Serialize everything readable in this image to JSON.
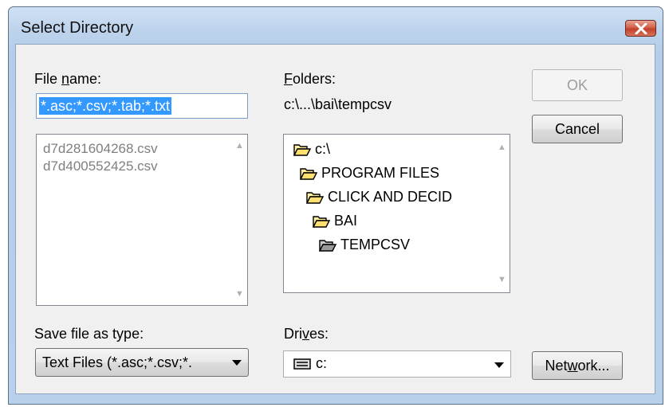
{
  "window": {
    "title": "Select Directory",
    "close_icon": "close-icon"
  },
  "file_name": {
    "label_pre": "File ",
    "label_key": "n",
    "label_post": "ame:",
    "value": "*.asc;*.csv;*.tab;*.txt",
    "files": [
      "d7d281604268.csv",
      "d7d400552425.csv"
    ]
  },
  "folders": {
    "label_key": "F",
    "label_post": "olders:",
    "current_path": "c:\\...\\bai\\tempcsv",
    "items": [
      {
        "name": "c:\\",
        "icon": "open-folder-icon"
      },
      {
        "name": "PROGRAM FILES",
        "icon": "open-folder-icon"
      },
      {
        "name": "CLICK AND DECID",
        "icon": "open-folder-icon"
      },
      {
        "name": "BAI",
        "icon": "open-folder-icon"
      },
      {
        "name": "TEMPCSV",
        "icon": "selected-folder-icon"
      }
    ]
  },
  "buttons": {
    "ok": "OK",
    "cancel": "Cancel",
    "network_pre": "Net",
    "network_key": "w",
    "network_post": "ork..."
  },
  "save_type": {
    "label": "Save file as type:",
    "value": "Text Files (*.asc;*.csv;*."
  },
  "drives": {
    "label_pre": "Dri",
    "label_key": "v",
    "label_post": "es:",
    "value": "c:",
    "icon": "drive-icon"
  },
  "colors": {
    "selection": "#3399ff",
    "close_button": "#c94a33",
    "frame": "#b9d0ea"
  }
}
